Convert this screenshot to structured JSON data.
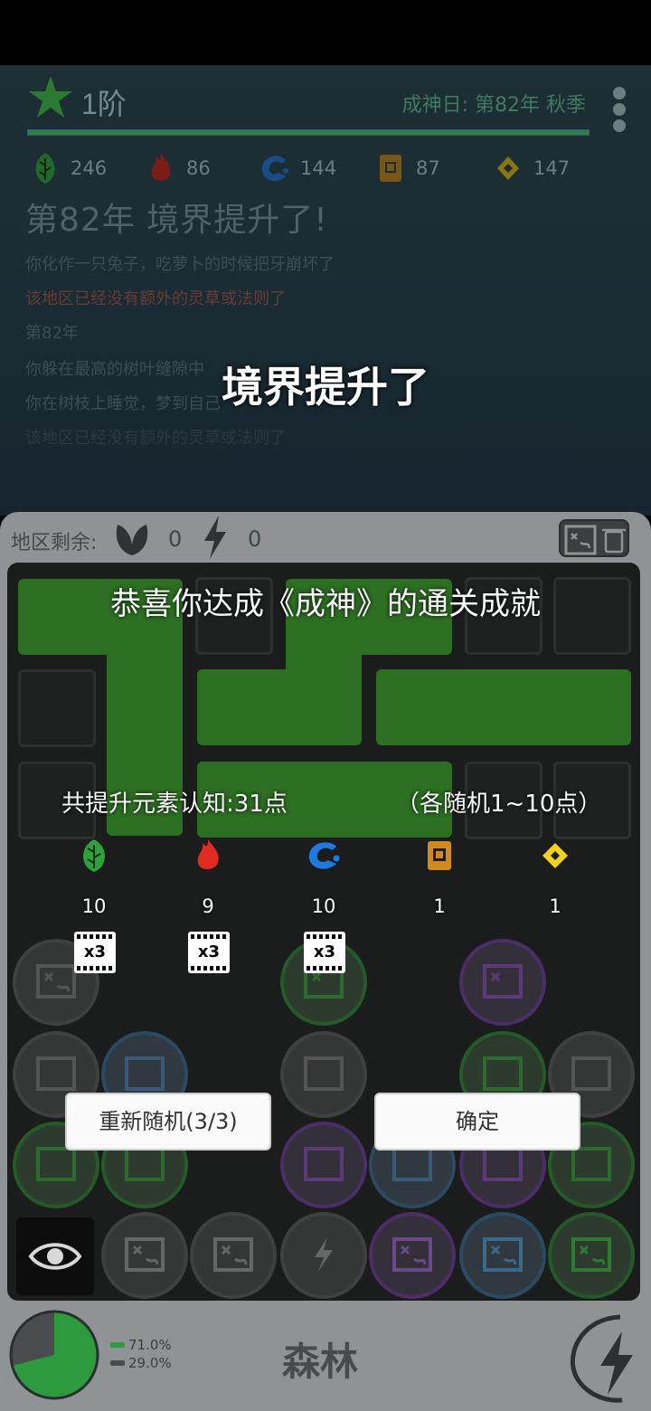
{
  "header": {
    "rank": "1阶",
    "date": "成神日: 第82年 秋季",
    "progress_percent": 100
  },
  "resources": [
    {
      "name": "wood-element",
      "value": "246",
      "color": "#2a8a3a"
    },
    {
      "name": "fire-element",
      "value": "86",
      "color": "#a5251f"
    },
    {
      "name": "water-element",
      "value": "144",
      "color": "#1f5fa5"
    },
    {
      "name": "earth-element",
      "value": "87",
      "color": "#a06a1a"
    },
    {
      "name": "metal-element",
      "value": "147",
      "color": "#b59a15"
    }
  ],
  "log": {
    "title": "第82年 境界提升了!",
    "lines": [
      "你化作一只兔子，吃萝卜的时候把牙崩坏了",
      "该地区已经没有额外的灵草或法则了",
      "第82年",
      "你躲在最高的树叶缝隙中",
      "你在树枝上睡觉，梦到自己",
      "该地区已经没有额外的灵草或法则了"
    ]
  },
  "overlay": {
    "center_message": "境界提升了",
    "congrats": "恭喜你达成《成神》的通关成就",
    "total_line": "共提升元素认知:31点",
    "range_line": "（各随机1~10点）",
    "elements": [
      {
        "icon": "wood-leaf-icon",
        "value": "10",
        "x3": "x3"
      },
      {
        "icon": "fire-flame-icon",
        "value": "9",
        "x3": "x3"
      },
      {
        "icon": "water-wave-icon",
        "value": "10",
        "x3": "x3"
      },
      {
        "icon": "earth-scroll-icon",
        "value": "1",
        "x3": ""
      },
      {
        "icon": "metal-diamond-icon",
        "value": "1",
        "x3": ""
      }
    ],
    "reroll_button": "重新随机(3/3)",
    "confirm_button": "确定"
  },
  "region": {
    "label": "地区剩余:",
    "herbs": "0",
    "laws": "0"
  },
  "footer": {
    "biome": "森林",
    "legend": [
      {
        "label": "71.0%",
        "color": "#2e9a3e"
      },
      {
        "label": "29.0%",
        "color": "#4a4d4f"
      }
    ],
    "pie_fraction": 0.71
  }
}
